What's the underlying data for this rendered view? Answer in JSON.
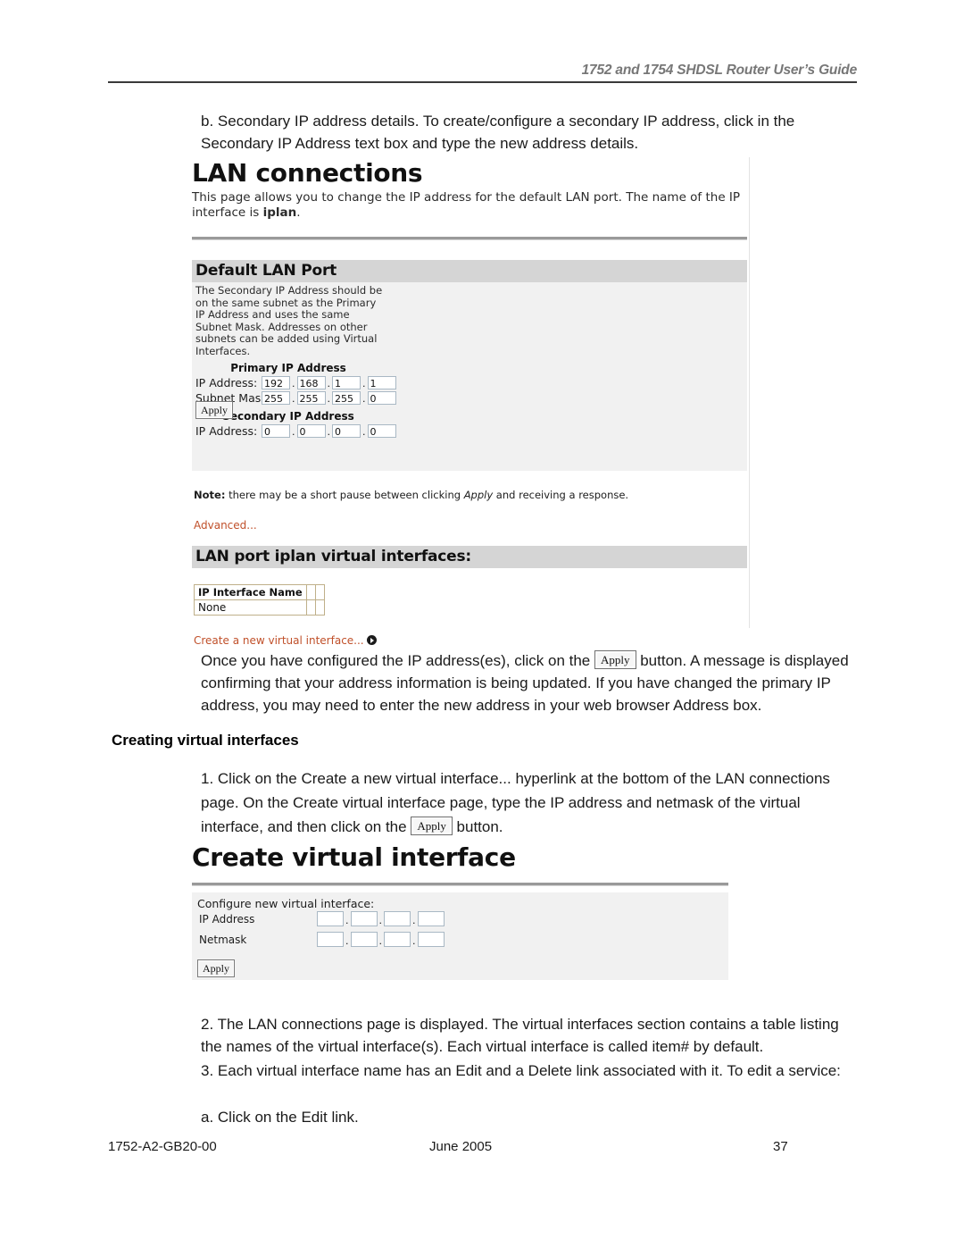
{
  "header": {
    "running_head": "1752 and 1754 SHDSL Router User’s Guide"
  },
  "intro_paragraph": "b. Secondary IP address details. To create/configure a secondary IP address, click in the Secondary IP Address text box and type the new address details.",
  "lan_connections_shot": {
    "title": "LAN connections",
    "intro_part1": "This page allows you to change the IP address for the default LAN port. The name of the IP interface is ",
    "intro_bold": "iplan",
    "intro_part2": ".",
    "section_heading": "Default LAN Port",
    "panel_note": "The Secondary IP Address should be on the same subnet as the Primary IP Address and uses the same Subnet Mask. Addresses on other subnets can be added using Virtual Interfaces.",
    "primary_group_label": "Primary IP Address",
    "secondary_group_label": "Secondary IP Address",
    "ip_address_label": "IP Address:",
    "subnet_mask_label": "Subnet Mask:",
    "primary_ip": [
      "192",
      "168",
      "1",
      "1"
    ],
    "subnet_mask": [
      "255",
      "255",
      "255",
      "0"
    ],
    "secondary_ip": [
      "0",
      "0",
      "0",
      "0"
    ],
    "apply_label": "Apply",
    "note_bold": "Note:",
    "note_text_1": " there may be a short pause between clicking ",
    "note_italic": "Apply",
    "note_text_2": " and receiving a response.",
    "advanced_link": "Advanced...",
    "virtual_heading": "LAN port iplan virtual interfaces:",
    "table": {
      "columns": [
        "IP Interface Name"
      ],
      "rows": [
        [
          "None"
        ]
      ]
    },
    "create_link": "Create a new virtual interface...",
    "create_link_icon": "circle-arrow-right-icon"
  },
  "paragraph_once": {
    "part1": "Once you have configured the IP address(es), click on the ",
    "button_label": "Apply",
    "part2": " button. A message is displayed confirming that your address information is being updated. If you have changed the primary IP address, you may need to enter the new address in your web browser Address box."
  },
  "creating_virtual_interfaces": {
    "heading": "Creating virtual interfaces",
    "step1_part1": "1. Click on the Create a new virtual interface... hyperlink at the bottom of the LAN connections page. On the Create virtual interface page, type the IP address and netmask of the virtual interface, and then click on the ",
    "step1_button": "Apply",
    "step1_part2": " button."
  },
  "create_virtual_interface_shot": {
    "title": "Create virtual interface",
    "configure_label": "Configure new virtual interface:",
    "ip_address_label": "IP Address",
    "netmask_label": "Netmask",
    "ip_address_values": [
      "",
      "",
      "",
      ""
    ],
    "netmask_values": [
      "",
      "",
      "",
      ""
    ],
    "apply_label": "Apply"
  },
  "steps_after": {
    "step2": "2. The LAN connections page is displayed. The virtual interfaces section contains a table listing the names of the virtual interface(s). Each virtual interface is called item# by default.",
    "step3": "3. Each virtual interface name has an Edit and a Delete link associated with it. To edit a service:",
    "step3a": "a. Click on the Edit link."
  },
  "footer": {
    "doc_number": "1752-A2-GB20-00",
    "date": "June 2005",
    "page_number": "37"
  },
  "colors": {
    "link": "#c0502a",
    "section_header_bg": "#d5d5d5",
    "panel_bg": "#f1f1f1",
    "table_border": "#bfb08a"
  }
}
